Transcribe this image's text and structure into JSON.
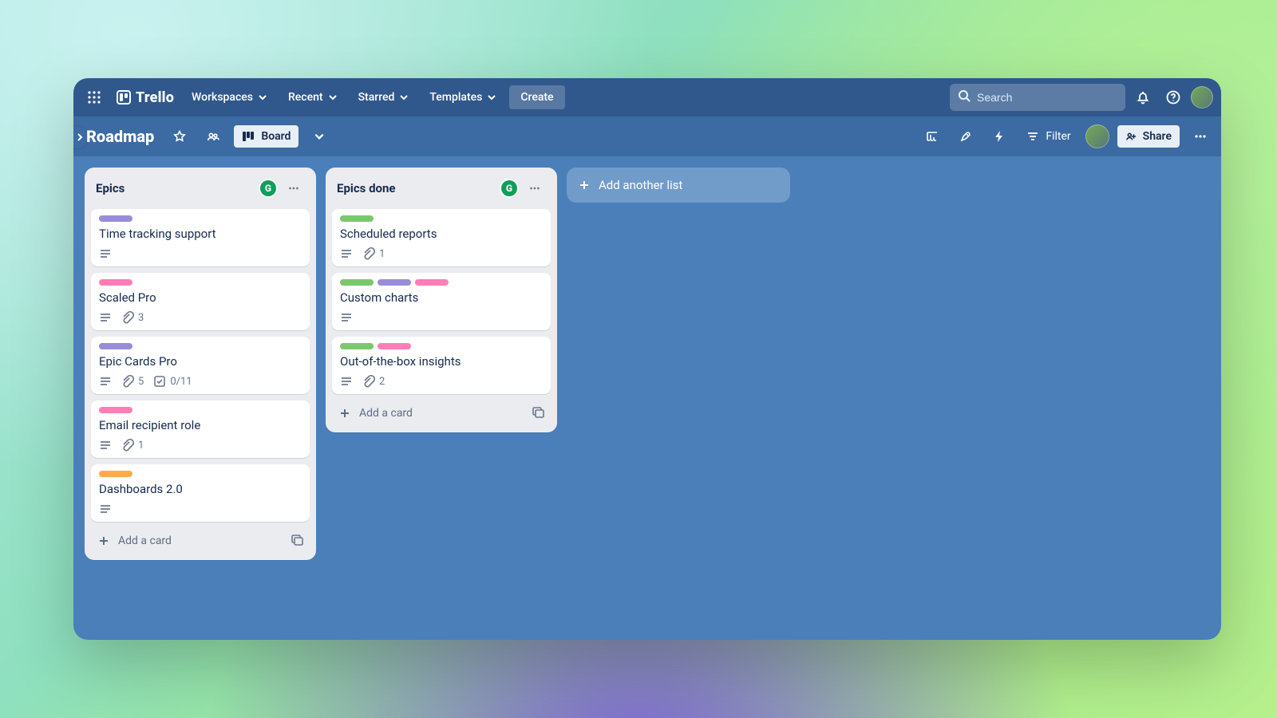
{
  "header": {
    "brand": "Trello",
    "menus": [
      "Workspaces",
      "Recent",
      "Starred",
      "Templates"
    ],
    "create": "Create",
    "search_placeholder": "Search"
  },
  "boardbar": {
    "name": "Roadmap",
    "view_label": "Board",
    "filter_label": "Filter",
    "share_label": "Share"
  },
  "lists": [
    {
      "title": "Epics",
      "cards": [
        {
          "title": "Time tracking support",
          "labels": [
            "purple"
          ],
          "badges": {
            "desc": true
          }
        },
        {
          "title": "Scaled Pro",
          "labels": [
            "pink"
          ],
          "badges": {
            "desc": true,
            "attachments": "3"
          }
        },
        {
          "title": "Epic Cards Pro",
          "labels": [
            "purple"
          ],
          "badges": {
            "desc": true,
            "attachments": "5",
            "checklist": "0/11"
          }
        },
        {
          "title": "Email recipient role",
          "labels": [
            "pink"
          ],
          "badges": {
            "desc": true,
            "attachments": "1"
          }
        },
        {
          "title": "Dashboards 2.0",
          "labels": [
            "orange"
          ],
          "badges": {
            "desc": true
          }
        }
      ],
      "add_card": "Add a card"
    },
    {
      "title": "Epics done",
      "cards": [
        {
          "title": "Scheduled reports",
          "labels": [
            "green"
          ],
          "badges": {
            "desc": true,
            "attachments": "1"
          }
        },
        {
          "title": "Custom charts",
          "labels": [
            "green",
            "purple",
            "pink"
          ],
          "badges": {
            "desc": true
          }
        },
        {
          "title": "Out-of-the-box insights",
          "labels": [
            "green",
            "pink"
          ],
          "badges": {
            "desc": true,
            "attachments": "2"
          }
        }
      ],
      "add_card": "Add a card"
    }
  ],
  "add_list": "Add another list",
  "colors": {
    "purple": "#998dd9",
    "pink": "#ff7eb6",
    "green": "#7bc86c",
    "orange": "#ffab4a"
  }
}
